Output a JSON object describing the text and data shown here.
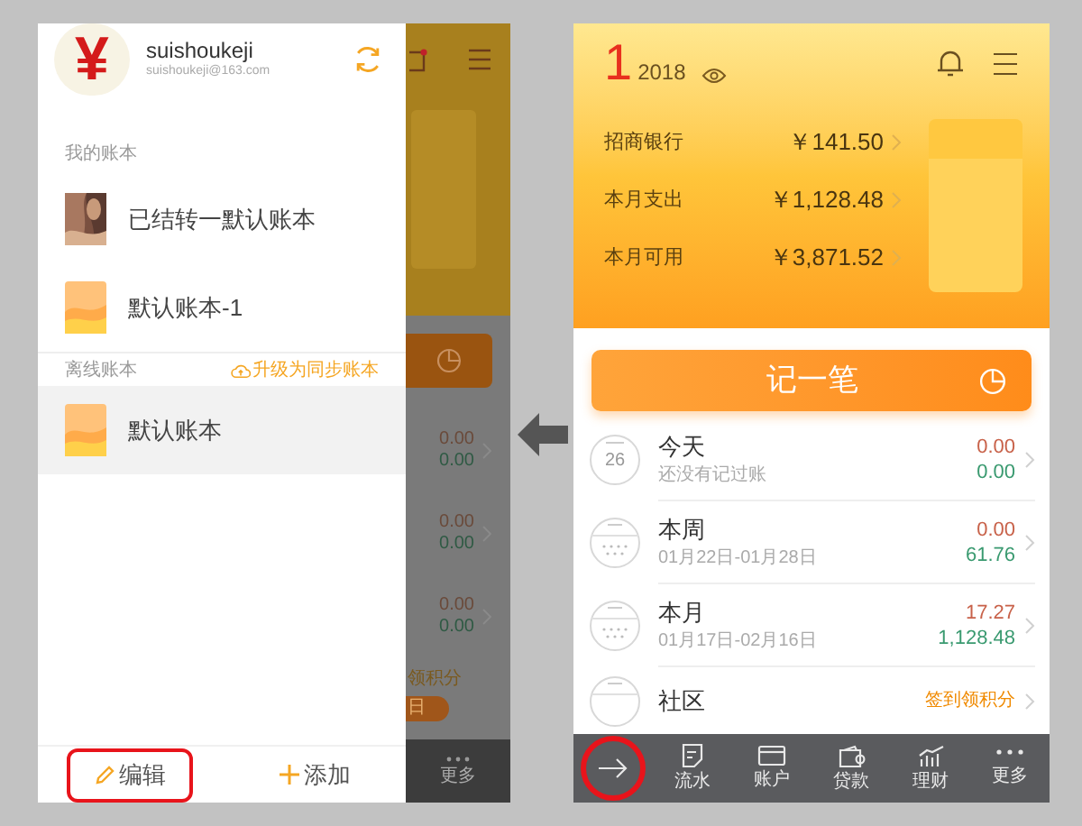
{
  "left_phone": {
    "drawer": {
      "profile": {
        "avatar_symbol": "¥",
        "username": "suishoukeji",
        "email": "suishoukeji@163.com"
      },
      "sections": [
        {
          "title": "我的账本",
          "books": [
            {
              "name": "已结转一默认账本",
              "kind": "picture",
              "selected": false
            },
            {
              "name": "默认账本-1",
              "kind": "cover",
              "selected": false
            }
          ]
        },
        {
          "title": "离线账本",
          "action": "升级为同步账本",
          "books": [
            {
              "name": "默认账本",
              "kind": "cover",
              "selected": true
            }
          ]
        }
      ],
      "footer": [
        {
          "kind": "edit",
          "label": "编辑",
          "highlighted": true
        },
        {
          "kind": "add",
          "label": "添加",
          "highlighted": false
        }
      ]
    },
    "background_app": {
      "rows": [
        {
          "expense": "0.00",
          "income": "0.00"
        },
        {
          "expense": "0.00",
          "income": "0.00"
        },
        {
          "expense": "0.00",
          "income": "0.00"
        }
      ],
      "promo": "领积分",
      "badge": "日",
      "more": "更多"
    }
  },
  "right_phone": {
    "header": {
      "month": "1",
      "year": "2018",
      "summary": [
        {
          "label": "招商银行",
          "amount": "￥141.50"
        },
        {
          "label": "本月支出",
          "amount": "￥1,128.48"
        },
        {
          "label": "本月可用",
          "amount": "￥3,871.52"
        }
      ]
    },
    "record_button": "记一笔",
    "periods": [
      {
        "kind": "day",
        "day": "26",
        "title": "今天",
        "subtitle": "还没有记过账",
        "expense": "0.00",
        "income": "0.00"
      },
      {
        "kind": "range",
        "title": "本周",
        "subtitle": "01月22日-01月28日",
        "expense": "0.00",
        "income": "61.76"
      },
      {
        "kind": "range",
        "title": "本月",
        "subtitle": "01月17日-02月16日",
        "expense": "17.27",
        "income": "1,128.48"
      },
      {
        "kind": "community",
        "title": "社区",
        "promo": "签到领积分"
      }
    ],
    "tab_bar": [
      {
        "kind": "arrow",
        "highlighted": true
      },
      {
        "kind": "note",
        "label": "流水",
        "highlighted": false
      },
      {
        "kind": "card",
        "label": "账户",
        "highlighted": false
      },
      {
        "kind": "wallet",
        "label": "贷款",
        "highlighted": false
      },
      {
        "kind": "chart",
        "label": "理财",
        "highlighted": false
      },
      {
        "kind": "more",
        "label": "更多",
        "highlighted": false
      }
    ]
  }
}
